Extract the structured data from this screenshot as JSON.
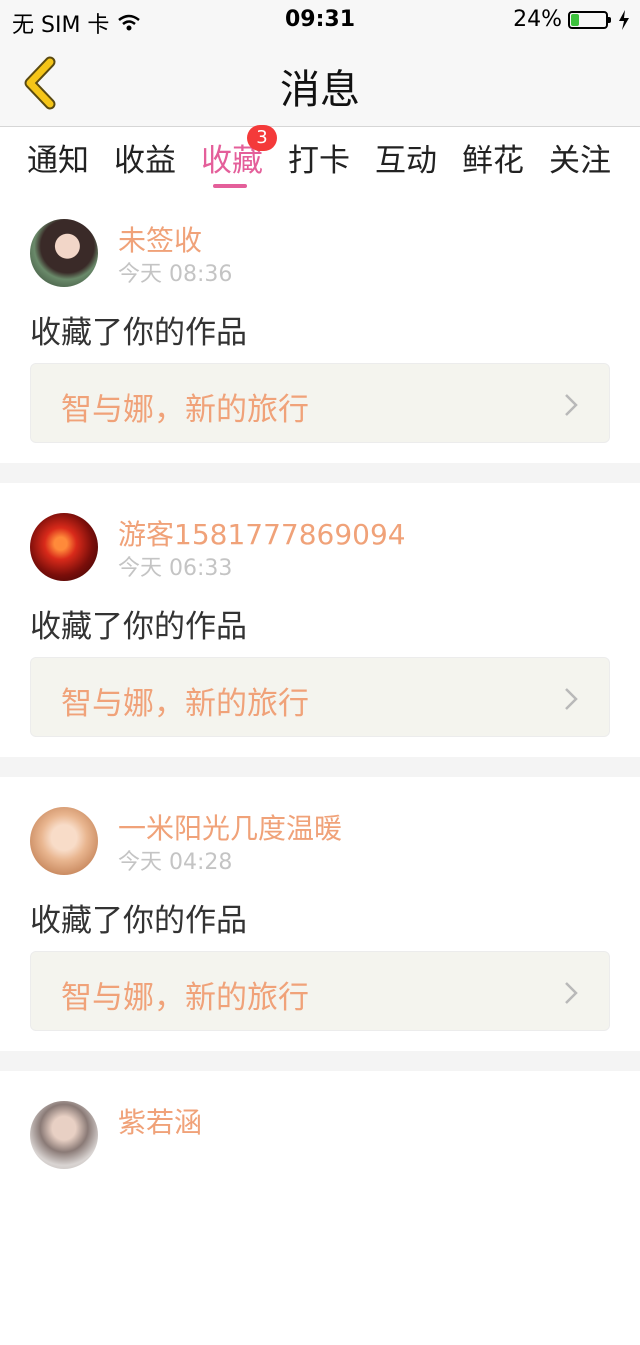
{
  "status_bar": {
    "carrier": "无 SIM 卡",
    "time": "09:31",
    "battery": "24%",
    "battery_level": 0.24
  },
  "nav": {
    "title": "消息",
    "back_icon": "chevron-left-icon"
  },
  "tabs": [
    {
      "label": "通知"
    },
    {
      "label": "收益"
    },
    {
      "label": "收藏",
      "active": true,
      "badge": "3"
    },
    {
      "label": "打卡"
    },
    {
      "label": "互动"
    },
    {
      "label": "鲜花"
    },
    {
      "label": "关注"
    }
  ],
  "messages": [
    {
      "user": "未签收",
      "time": "今天 08:36",
      "action": "收藏了你的作品",
      "work": "智与娜，新的旅行"
    },
    {
      "user": "游客1581777869094",
      "time": "今天 06:33",
      "action": "收藏了你的作品",
      "work": "智与娜，新的旅行"
    },
    {
      "user": "一米阳光几度温暖",
      "time": "今天 04:28",
      "action": "收藏了你的作品",
      "work": "智与娜，新的旅行"
    },
    {
      "user": "紫若涵"
    }
  ],
  "colors": {
    "accent": "#e45f9a",
    "username": "#f0a279",
    "badge": "#f43a3a",
    "back_arrow": "#f5c518"
  }
}
